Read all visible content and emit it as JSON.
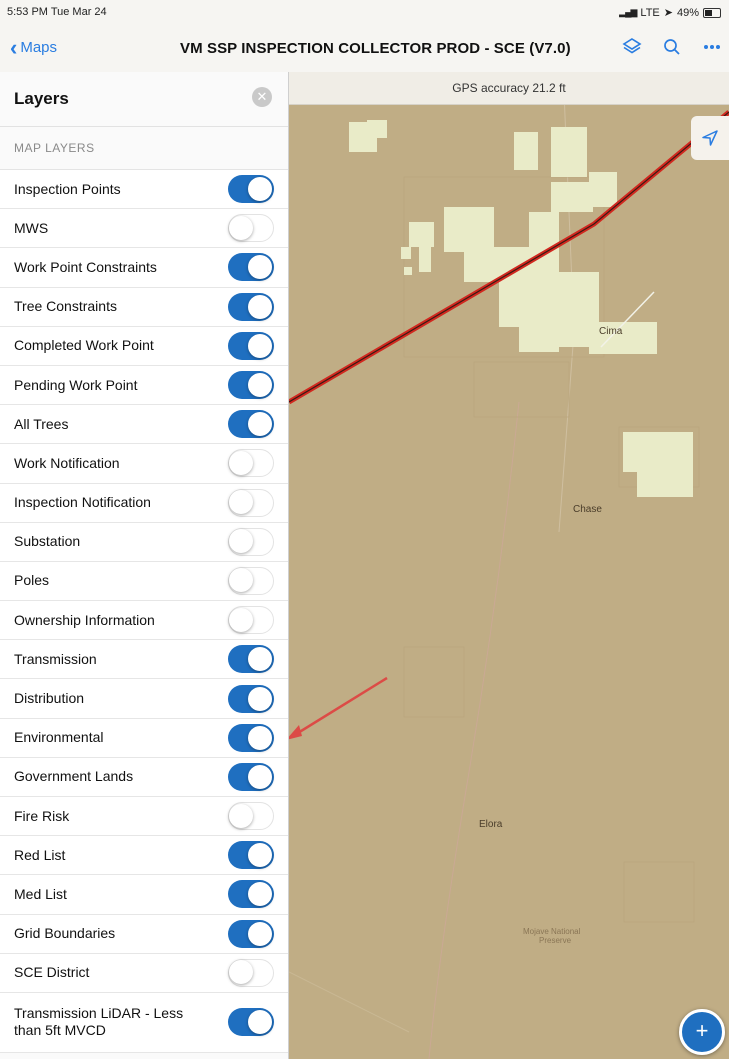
{
  "status_bar": {
    "time": "5:53 PM  Tue Mar 24",
    "network": "LTE",
    "battery": "49%"
  },
  "nav": {
    "back_label": "Maps",
    "title": "VM SSP INSPECTION COLLECTOR PROD - SCE (V7.0)"
  },
  "panel": {
    "title": "Layers",
    "section_label": "MAP LAYERS",
    "layers": [
      {
        "label": "Inspection Points",
        "on": true
      },
      {
        "label": "MWS",
        "on": false
      },
      {
        "label": "Work Point Constraints",
        "on": true
      },
      {
        "label": "Tree Constraints",
        "on": true
      },
      {
        "label": "Completed Work Point",
        "on": true
      },
      {
        "label": "Pending Work Point",
        "on": true
      },
      {
        "label": "All Trees",
        "on": true
      },
      {
        "label": "Work Notification",
        "on": false
      },
      {
        "label": "Inspection Notification",
        "on": false
      },
      {
        "label": "Substation",
        "on": false
      },
      {
        "label": "Poles",
        "on": false
      },
      {
        "label": "Ownership Information",
        "on": false
      },
      {
        "label": "Transmission",
        "on": true
      },
      {
        "label": "Distribution",
        "on": true
      },
      {
        "label": "Environmental",
        "on": true
      },
      {
        "label": "Government Lands",
        "on": true
      },
      {
        "label": "Fire Risk",
        "on": false
      },
      {
        "label": "Red List",
        "on": true
      },
      {
        "label": "Med List",
        "on": true
      },
      {
        "label": "Grid Boundaries",
        "on": true
      },
      {
        "label": "SCE District",
        "on": false
      },
      {
        "label": "Transmission LiDAR - Less than 5ft MVCD",
        "on": true
      }
    ]
  },
  "map": {
    "gps_text": "GPS accuracy 21.2 ft",
    "places": {
      "cima": "Cima",
      "chase": "Chase",
      "elora": "Elora",
      "mojave1": "Mojave National",
      "mojave2": "Preserve"
    },
    "fab_label": "+"
  },
  "colors": {
    "accent": "#1f6fc0",
    "link": "#2a7de1",
    "map_bg": "#c0ad85",
    "parcel": "#e9ebc8",
    "line": "#d1281f"
  }
}
